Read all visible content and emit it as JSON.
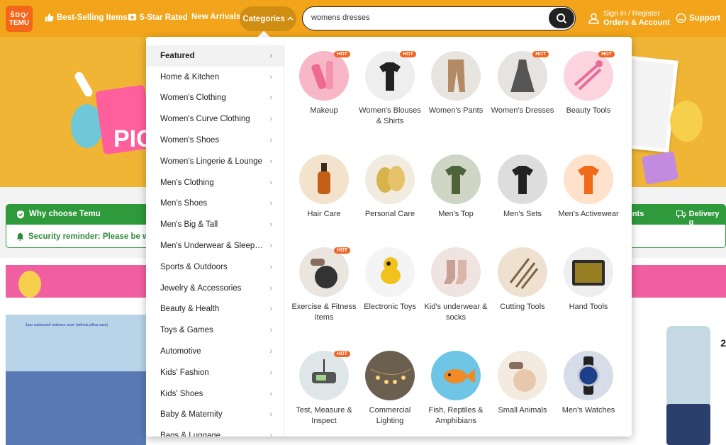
{
  "header": {
    "logo_line1": "ŠŊQ⁄",
    "logo_line2": "TEMU",
    "nav": [
      {
        "label": "Best-Selling Items",
        "icon": "thumbs-up-icon"
      },
      {
        "label": "5-Star Rated",
        "icon": "star-box-icon"
      },
      {
        "label": "New Arrivals",
        "icon": ""
      }
    ],
    "categories_label": "Categories",
    "search_value": "womens dresses",
    "account_line1": "Sign in / Register",
    "account_line2": "Orders & Account",
    "support_label": "Support"
  },
  "background": {
    "banner_text": "PIC",
    "why_title": "Why choose Temu",
    "why_right_1": "nents",
    "why_right_2": "Delivery g",
    "security": "Security reminder: Please be wa",
    "product_caption": "1pcs waterproof mattress cover (without pillow case)",
    "price_fragment": "2"
  },
  "dropdown": {
    "categories": [
      "Featured",
      "Home & Kitchen",
      "Women's Clothing",
      "Women's Curve Clothing",
      "Women's Shoes",
      "Women's Lingerie & Lounge",
      "Men's Clothing",
      "Men's Shoes",
      "Men's Big & Tall",
      "Men's Underwear & Sleepwear",
      "Sports & Outdoors",
      "Jewelry & Accessories",
      "Beauty & Health",
      "Toys & Games",
      "Automotive",
      "Kids' Fashion",
      "Kids' Shoes",
      "Baby & Maternity",
      "Bags & Luggage"
    ],
    "hot_label": "HOT",
    "items": [
      {
        "name": "Makeup",
        "hot": true
      },
      {
        "name": "Women's Blouses & Shirts",
        "hot": true
      },
      {
        "name": "Women's Pants",
        "hot": false
      },
      {
        "name": "Women's Dresses",
        "hot": true
      },
      {
        "name": "Beauty Tools",
        "hot": true
      },
      {
        "name": "Hair Care",
        "hot": false
      },
      {
        "name": "Personal Care",
        "hot": false
      },
      {
        "name": "Men's Top",
        "hot": false
      },
      {
        "name": "Men's Sets",
        "hot": false
      },
      {
        "name": "Men's Activewear",
        "hot": false
      },
      {
        "name": "Exercise & Fitness Items",
        "hot": true
      },
      {
        "name": "Electronic Toys",
        "hot": false
      },
      {
        "name": "Kid's underwear & socks",
        "hot": false
      },
      {
        "name": "Cutting Tools",
        "hot": false
      },
      {
        "name": "Hand Tools",
        "hot": false
      },
      {
        "name": "Test, Measure & Inspect",
        "hot": true
      },
      {
        "name": "Commercial Lighting",
        "hot": false
      },
      {
        "name": "Fish, Reptiles & Amphibians",
        "hot": false
      },
      {
        "name": "Small Animals",
        "hot": false
      },
      {
        "name": "Men's Watches",
        "hot": false
      }
    ]
  }
}
